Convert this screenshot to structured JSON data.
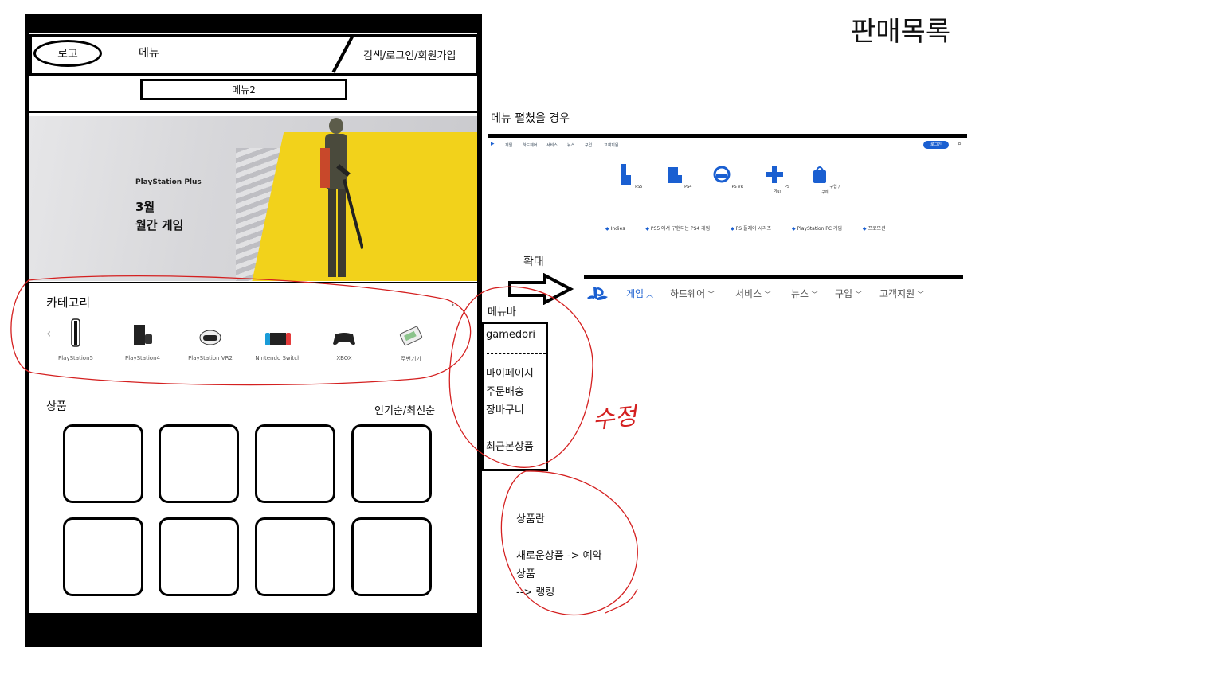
{
  "page_title": "판매목록",
  "wireframe": {
    "header": {
      "logo": "로고",
      "menu": "메뉴",
      "utility": "검색/로그인/회원가입",
      "menu2": "메뉴2"
    },
    "banner": {
      "brand": "PlayStation Plus",
      "month": "3월",
      "subtitle": "월간 게임"
    },
    "category": {
      "title": "카테고리",
      "next": "›",
      "prev": "‹",
      "items": [
        {
          "label": "PlayStation5",
          "icon": "ps5-console-icon"
        },
        {
          "label": "PlayStation4",
          "icon": "ps4-console-icon"
        },
        {
          "label": "PlayStation VR2",
          "icon": "vr-headset-icon"
        },
        {
          "label": "Nintendo Switch",
          "icon": "switch-console-icon"
        },
        {
          "label": "XBOX",
          "icon": "xbox-controller-icon"
        },
        {
          "label": "주변기기",
          "icon": "accessory-icon"
        }
      ]
    },
    "products": {
      "title": "상품",
      "sort": "인기순/최신순",
      "slots": 8
    }
  },
  "annotations": {
    "menu_open": "메뉴 펼쳤을 경우",
    "mini_nav": [
      "게임",
      "하드웨어",
      "서비스",
      "뉴스",
      "구입",
      "고객지원"
    ],
    "mini_pill": "로그인",
    "mini_products": [
      "PS5",
      "PS4",
      "PS VR",
      "PS Plus",
      "구입 / 구매"
    ],
    "mini_links": [
      "Indies",
      "PS5 에서 구현되는 PS4 게임",
      "PS 플레이 시리즈",
      "PlayStation PC 게임",
      "프로모션"
    ],
    "expand_label": "확대",
    "nav": [
      {
        "label": "게임",
        "active": true
      },
      {
        "label": "하드웨어",
        "active": false
      },
      {
        "label": "서비스",
        "active": false
      },
      {
        "label": "뉴스",
        "active": false
      },
      {
        "label": "구입",
        "active": false
      },
      {
        "label": "고객지원",
        "active": false
      }
    ],
    "menubar_label": "메뉴바",
    "menubar": {
      "user": "gamedori",
      "items": [
        "마이페이지",
        "주문배송",
        "장바구니"
      ],
      "recent": "최근본상품"
    },
    "handwritten": "수정",
    "notes": [
      "상품란",
      "새로운상품 -> 예약",
      "상품",
      "--> 랭킹"
    ]
  },
  "colors": {
    "ps_blue": "#1a5fd1",
    "markup_red": "#d42020",
    "banner_yellow": "#f2d21b"
  }
}
